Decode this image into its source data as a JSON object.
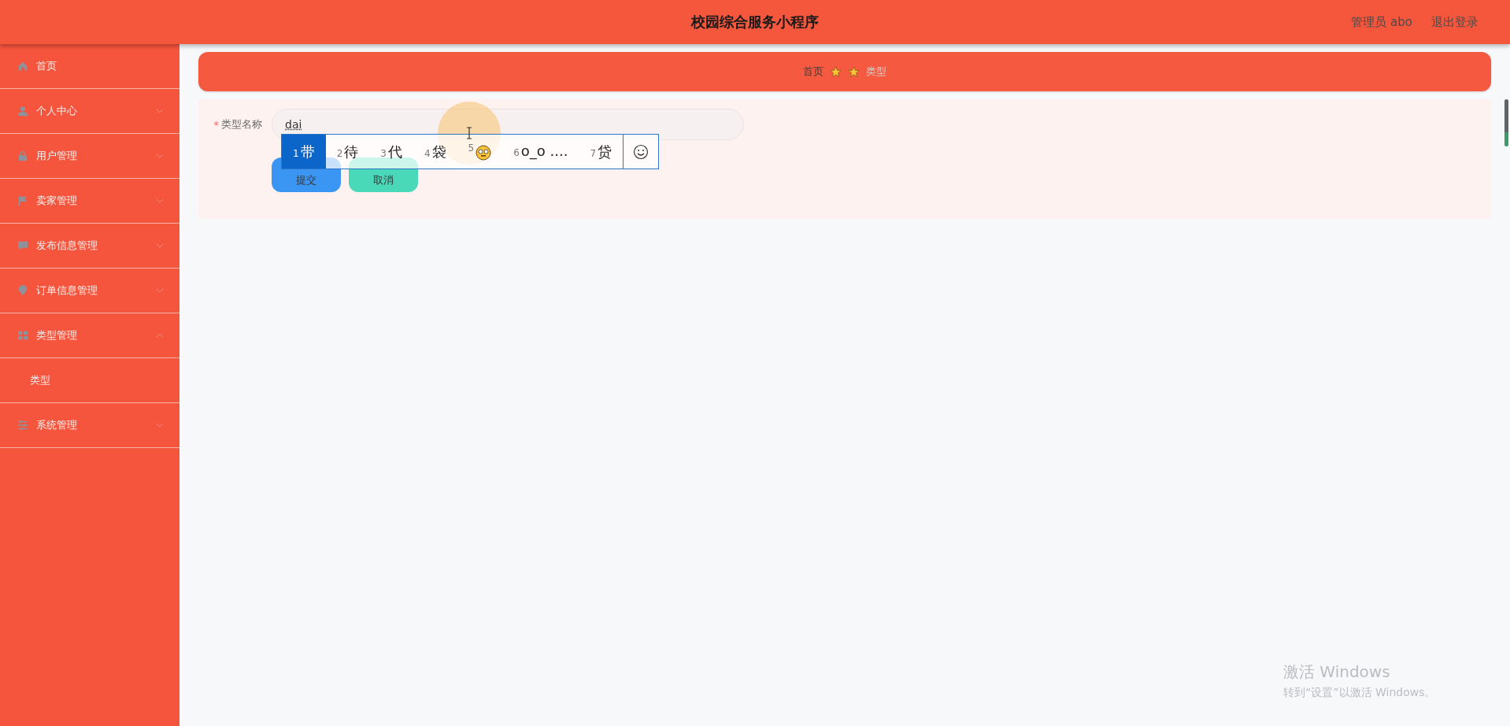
{
  "header": {
    "title": "校园综合服务小程序",
    "user": "管理员 abo",
    "logout": "退出登录"
  },
  "sidebar": {
    "items": [
      {
        "label": "首页",
        "kind": "link"
      },
      {
        "label": "个人中心",
        "kind": "menu",
        "expanded": false
      },
      {
        "label": "用户管理",
        "kind": "menu",
        "expanded": false
      },
      {
        "label": "卖家管理",
        "kind": "menu",
        "expanded": false
      },
      {
        "label": "发布信息管理",
        "kind": "menu",
        "expanded": false
      },
      {
        "label": "订单信息管理",
        "kind": "menu",
        "expanded": false
      },
      {
        "label": "类型管理",
        "kind": "menu",
        "expanded": true,
        "children": [
          {
            "label": "类型"
          }
        ]
      },
      {
        "label": "系统管理",
        "kind": "menu",
        "expanded": false
      }
    ]
  },
  "breadcrumb": [
    {
      "label": "首页",
      "current": false
    },
    {
      "label": "类型",
      "current": true
    }
  ],
  "form": {
    "field": {
      "label": "类型名称",
      "required_mark": "*",
      "value": "dai"
    },
    "buttons": [
      {
        "label": "提交",
        "kind": "primary"
      },
      {
        "label": "取消",
        "kind": "secondary"
      }
    ]
  },
  "ime": {
    "candidates": [
      {
        "index": "1",
        "text": "带",
        "kind": "text",
        "selected": true
      },
      {
        "index": "2",
        "text": "待",
        "kind": "text",
        "selected": false
      },
      {
        "index": "3",
        "text": "代",
        "kind": "text",
        "selected": false
      },
      {
        "index": "4",
        "text": "袋",
        "kind": "text",
        "selected": false
      },
      {
        "index": "5",
        "kind": "emoji",
        "selected": false
      },
      {
        "index": "6",
        "text": "o_o ....",
        "kind": "text",
        "selected": false
      },
      {
        "index": "7",
        "text": "贷",
        "kind": "text",
        "selected": false
      }
    ]
  },
  "activation": {
    "title": "激活 Windows",
    "hint": "转到“设置”以激活 Windows。"
  }
}
